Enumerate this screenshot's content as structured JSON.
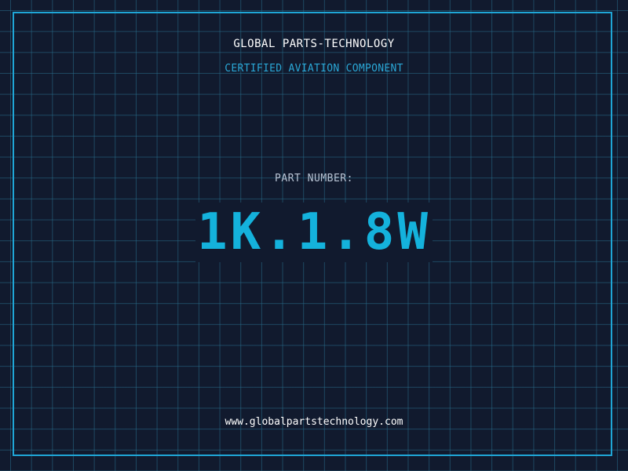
{
  "header": {
    "company": "GLOBAL PARTS-TECHNOLOGY",
    "tagline": "CERTIFIED AVIATION COMPONENT"
  },
  "part": {
    "label": "PART NUMBER:",
    "number": "1K.1.8W"
  },
  "footer": {
    "website": "www.globalpartstechnology.com"
  },
  "colors": {
    "background": "#111a2e",
    "grid": "#286e8c",
    "frame": "#1fa6d6",
    "accent": "#14b2dc"
  }
}
